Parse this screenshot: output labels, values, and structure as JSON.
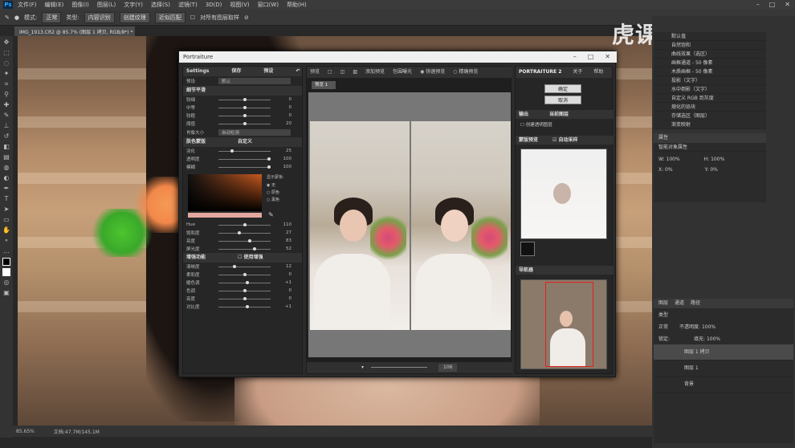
{
  "app": {
    "icon": "Ps",
    "menus": [
      "文件(F)",
      "编辑(E)",
      "图像(I)",
      "图层(L)",
      "文字(Y)",
      "选择(S)",
      "滤镜(T)",
      "3D(D)",
      "视图(V)",
      "窗口(W)",
      "帮助(H)"
    ]
  },
  "options": {
    "mode_label": "模式:",
    "mode_value": "正常",
    "type_label": "类型:",
    "btn1": "内容识别",
    "btn2": "创建纹理",
    "btn3": "近似匹配",
    "sample_all": "对所有图层取样"
  },
  "document": {
    "tab": "IMG_1913.CR2 @ 85.7% (图层 1 拷贝, RGB/8*) *",
    "zoom": "85.65%",
    "docsize": "文档:47.7M/145.1M"
  },
  "watermark": "虎课网",
  "dock": {
    "adjust_rows": [
      "默认值",
      "自然饱和",
      "曲线效果（选区）",
      "画框通道 - 50 像素",
      "木质画框 - 50 像素",
      "投影（文字）",
      "水中倒影（文字）",
      "自定义 RGB 到灰度",
      "熔化的铅块",
      "存储选区（图层）",
      "渐变映射"
    ],
    "props_tab": "属性",
    "props_title": "智能对象属性",
    "w": "W: 100%",
    "h": "H: 100%",
    "x": "X: 0%",
    "y": "Y: 0%",
    "layer_tabs": [
      "图层",
      "通道",
      "路径"
    ],
    "kind": "类型",
    "blend": "正常",
    "opacity": "不透明度: 100%",
    "lock": "锁定:",
    "fill": "填充: 100%",
    "layers": [
      "图层 1 拷贝",
      "图层 1",
      "背景"
    ]
  },
  "portraiture": {
    "title": "Portraiture",
    "left": {
      "settings": "Settings",
      "save": "保存",
      "preset_btn": "预设",
      "preset_label": "预设",
      "preset_value": "默认",
      "detail_title": "细节平滑",
      "sliders": [
        {
          "label": "较细",
          "value": "0",
          "pct": 0.5
        },
        {
          "label": "中等",
          "value": "0",
          "pct": 0.5
        },
        {
          "label": "较粗",
          "value": "0",
          "pct": 0.5
        },
        {
          "label": "阈值",
          "value": "20",
          "pct": 0.5
        }
      ],
      "portrait_size": "肖像大小",
      "portrait_size_value": "自动检测",
      "mask_title": "肤色蒙版",
      "mask_mode": "自定义",
      "mask_sliders": [
        {
          "label": "羽化",
          "value": "25",
          "pct": 0.25
        },
        {
          "label": "透明度",
          "value": "100",
          "pct": 1
        },
        {
          "label": "模糊",
          "value": "100",
          "pct": 1
        }
      ],
      "display_mask": "显示蒙板:",
      "opts": [
        "无",
        "原色",
        "黑色"
      ],
      "hsl": [
        {
          "label": "Hue",
          "value": "110",
          "pct": 0.5
        },
        {
          "label": "饱和度",
          "value": "27",
          "pct": 0.4
        },
        {
          "label": "亮度",
          "value": "83",
          "pct": 0.6
        },
        {
          "label": "屏光度",
          "value": "52",
          "pct": 0.7
        }
      ],
      "enhance_title": "增强功能",
      "use_enhance": "使用增强",
      "enh": [
        {
          "label": "清晰度",
          "value": "12",
          "pct": 0.3
        },
        {
          "label": "柔和度",
          "value": "0",
          "pct": 0.5
        },
        {
          "label": "暖色调",
          "value": "+1",
          "pct": 0.55
        },
        {
          "label": "色调",
          "value": "0",
          "pct": 0.5
        },
        {
          "label": "亮度",
          "value": "0",
          "pct": 0.5
        },
        {
          "label": "对比度",
          "value": "+1",
          "pct": 0.55
        }
      ]
    },
    "mid": {
      "preview": "预览",
      "add_preview": "添加预览",
      "exposure": "包围曝光",
      "fast": "快速预览",
      "precise": "精确预览",
      "tab": "预览 1",
      "zoom": "106"
    },
    "right": {
      "name": "PORTRAITURE 2",
      "about": "关于",
      "help": "帮助",
      "ok": "确定",
      "cancel": "取消",
      "output": "输出",
      "output_value": "当前图层",
      "new_layer": "创建透明图层",
      "mask_preview": "蒙版预览",
      "auto_pick": "自动采样",
      "navigator": "导航器"
    }
  }
}
